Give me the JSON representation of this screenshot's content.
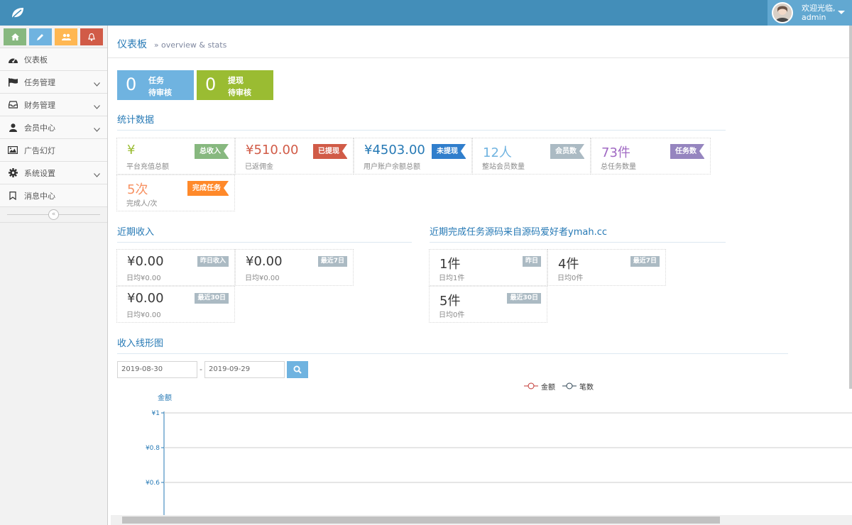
{
  "topbar": {
    "welcome_line1": "欢迎光临,",
    "welcome_line2": "admin",
    "bg_color": "#438eb9"
  },
  "sidebar": {
    "shortcuts": [
      {
        "icon": "home-icon",
        "color": "#87b87f"
      },
      {
        "icon": "pencil-icon",
        "color": "#6fb3e0"
      },
      {
        "icon": "users-icon",
        "color": "#ffb752"
      },
      {
        "icon": "bell-icon",
        "color": "#d15b47"
      }
    ],
    "items": [
      {
        "label": "仪表板",
        "icon": "dashboard-icon",
        "has_submenu": false
      },
      {
        "label": "任务管理",
        "icon": "flag-icon",
        "has_submenu": true
      },
      {
        "label": "财务管理",
        "icon": "inbox-icon",
        "has_submenu": true
      },
      {
        "label": "会员中心",
        "icon": "user-icon",
        "has_submenu": true
      },
      {
        "label": "广告幻灯",
        "icon": "picture-icon",
        "has_submenu": false
      },
      {
        "label": "系统设置",
        "icon": "gear-icon",
        "has_submenu": true
      },
      {
        "label": "消息中心",
        "icon": "bookmark-icon",
        "has_submenu": false
      }
    ],
    "collapse_glyph": "«"
  },
  "breadcrumb": {
    "title": "仪表板",
    "subtitle": "» overview & stats"
  },
  "pending": [
    {
      "count": "0",
      "line1": "任务",
      "line2": "待审核",
      "color": "#6fb3e0"
    },
    {
      "count": "0",
      "line1": "提现",
      "line2": "待审核",
      "color": "#9abc32"
    }
  ],
  "stats": {
    "heading": "统计数据",
    "cards": [
      {
        "value": "¥",
        "label": "平台充值总额",
        "tag": "总收入",
        "value_color": "#9abc32",
        "tag_color": "#87b87f"
      },
      {
        "value": "¥510.00",
        "label": "已返佣金",
        "tag": "已提现",
        "value_color": "#d15b47",
        "tag_color": "#d15b47"
      },
      {
        "value": "¥4503.00",
        "label": "用户账户余额总额",
        "tag": "未提现",
        "value_color": "#2679b5",
        "tag_color": "#307ecc"
      },
      {
        "value": "12人",
        "label": "整站会员数量",
        "tag": "会员数",
        "value_color": "#6fb3e0",
        "tag_color": "#abbac3"
      },
      {
        "value": "73件",
        "label": "总任务数量",
        "tag": "任务数",
        "value_color": "#a069c3",
        "tag_color": "#9585bf"
      },
      {
        "value": "5次",
        "label": "完成人/次",
        "tag": "完成任务",
        "value_color": "#f79263",
        "tag_color": "#ff892a"
      }
    ]
  },
  "income": {
    "heading": "近期收入",
    "cards": [
      {
        "value": "¥0.00",
        "sub": "日均¥0.00",
        "badge": "昨日收入"
      },
      {
        "value": "¥0.00",
        "sub": "日均¥0.00",
        "badge": "最近7日"
      },
      {
        "value": "¥0.00",
        "sub": "日均¥0.00",
        "badge": "最近30日"
      }
    ]
  },
  "tasks": {
    "heading": "近期完成任务源码来自源码爱好者ymah.cc",
    "cards": [
      {
        "value": "1件",
        "sub": "日均1件",
        "badge": "昨日"
      },
      {
        "value": "4件",
        "sub": "日均0件",
        "badge": "最近7日"
      },
      {
        "value": "5件",
        "sub": "日均0件",
        "badge": "最近30日"
      }
    ]
  },
  "chart_section": {
    "heading": "收入线形图",
    "date_from": "2019-08-30",
    "date_sep": "-",
    "date_to": "2019-09-29"
  },
  "chart_data": {
    "type": "line",
    "ylabel": "金额",
    "legend": [
      "金额",
      "笔数"
    ],
    "legend_placement": "top-center",
    "series": [
      {
        "name": "金额",
        "color": "#c23531"
      },
      {
        "name": "笔数",
        "color": "#2f4554"
      }
    ],
    "yticks": [
      "¥1",
      "¥0.8",
      "¥0.6"
    ],
    "ytick_values": [
      1,
      0.8,
      0.6
    ],
    "grid": true
  }
}
